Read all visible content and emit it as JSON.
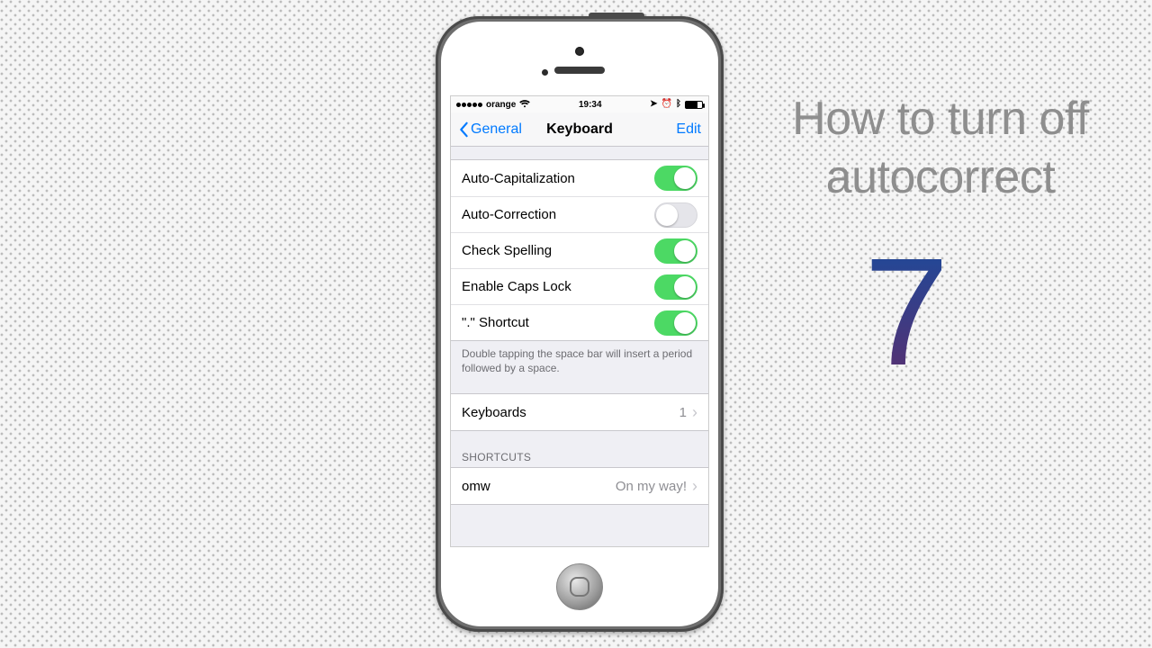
{
  "headline": {
    "line1": "How to turn off",
    "line2": "autocorrect",
    "glyph": "7"
  },
  "statusbar": {
    "carrier": "orange",
    "time": "19:34"
  },
  "nav": {
    "back_label": "General",
    "title": "Keyboard",
    "edit_label": "Edit"
  },
  "settings": {
    "rows": [
      {
        "label": "Auto-Capitalization",
        "on": true
      },
      {
        "label": "Auto-Correction",
        "on": false
      },
      {
        "label": "Check Spelling",
        "on": true
      },
      {
        "label": "Enable Caps Lock",
        "on": true
      },
      {
        "label": "\".\" Shortcut",
        "on": true
      }
    ],
    "footer": "Double tapping the space bar will insert a period followed by a space."
  },
  "keyboards": {
    "label": "Keyboards",
    "count": "1"
  },
  "shortcuts": {
    "header": "SHORTCUTS",
    "items": [
      {
        "key": "omw",
        "value": "On my way!"
      }
    ]
  },
  "colors": {
    "ios_blue": "#007aff",
    "switch_green": "#4cd964",
    "group_bg": "#efeff4"
  }
}
